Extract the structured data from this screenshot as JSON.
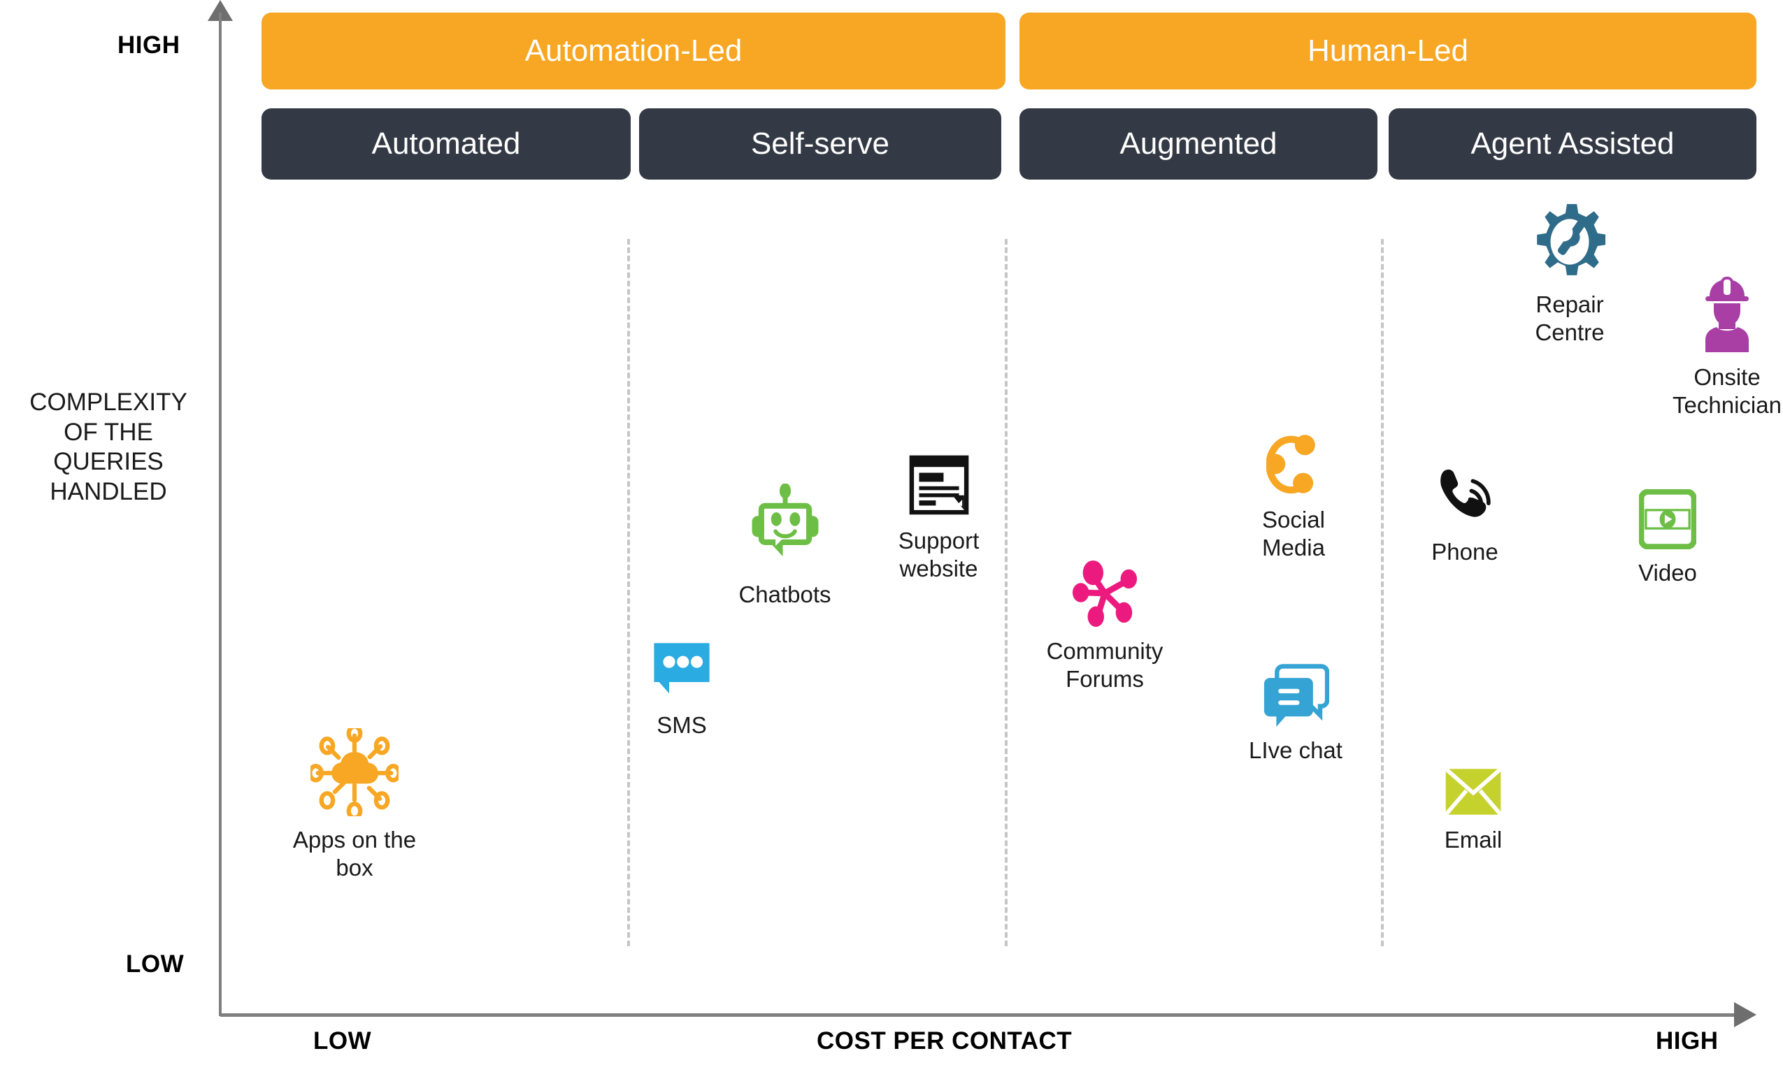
{
  "axes": {
    "y_title": "COMPLEXITY\nOF THE\nQUERIES\nHANDLED",
    "y_high": "HIGH",
    "y_low": "LOW",
    "x_title": "COST PER CONTACT",
    "x_low": "LOW",
    "x_high": "HIGH"
  },
  "groups": [
    {
      "id": "automation-led",
      "label": "Automation-Led",
      "color": "#f7a723"
    },
    {
      "id": "human-led",
      "label": "Human-Led",
      "color": "#f7a723"
    }
  ],
  "columns": [
    {
      "id": "automated",
      "label": "Automated",
      "color": "#343a45"
    },
    {
      "id": "self-serve",
      "label": "Self-serve",
      "color": "#343a45"
    },
    {
      "id": "augmented",
      "label": "Augmented",
      "color": "#343a45"
    },
    {
      "id": "agent-assisted",
      "label": "Agent Assisted",
      "color": "#343a45"
    }
  ],
  "items": [
    {
      "id": "apps-on-the-box",
      "label": "Apps on the\nbox",
      "icon": "network-cloud-icon",
      "color": "#f7a723",
      "column": "automated"
    },
    {
      "id": "sms",
      "label": "SMS",
      "icon": "sms-bubble-icon",
      "color": "#2aabe2",
      "column": "self-serve"
    },
    {
      "id": "chatbots",
      "label": "Chatbots",
      "icon": "robot-icon",
      "color": "#6cbe45",
      "column": "self-serve"
    },
    {
      "id": "support-website",
      "label": "Support\nwebsite",
      "icon": "document-page-icon",
      "color": "#111111",
      "column": "self-serve"
    },
    {
      "id": "community-forums",
      "label": "Community\nForums",
      "icon": "hub-network-icon",
      "color": "#ec1a7e",
      "column": "augmented"
    },
    {
      "id": "social-media",
      "label": "Social\nMedia",
      "icon": "share-nodes-icon",
      "color": "#f7a723",
      "column": "augmented"
    },
    {
      "id": "live-chat",
      "label": "LIve chat",
      "icon": "chat-bubbles-icon",
      "color": "#35a3d4",
      "column": "augmented"
    },
    {
      "id": "phone",
      "label": "Phone",
      "icon": "phone-ringing-icon",
      "color": "#111111",
      "column": "agent-assisted"
    },
    {
      "id": "email",
      "label": "Email",
      "icon": "envelope-icon",
      "color": "#c5d22e",
      "column": "agent-assisted"
    },
    {
      "id": "repair-centre",
      "label": "Repair\nCentre",
      "icon": "gear-wrench-icon",
      "color": "#2e6c8a",
      "column": "agent-assisted"
    },
    {
      "id": "onsite-technician",
      "label": "Onsite\nTechnician",
      "icon": "technician-icon",
      "color": "#a93fa5",
      "column": "agent-assisted"
    },
    {
      "id": "video",
      "label": "Video",
      "icon": "film-play-icon",
      "color": "#6cbe45",
      "column": "agent-assisted"
    }
  ],
  "chart_data": {
    "type": "scatter",
    "title": "",
    "xlabel": "COST PER CONTACT",
    "ylabel": "COMPLEXITY OF THE QUERIES HANDLED",
    "xlim": [
      "LOW",
      "HIGH"
    ],
    "ylim": [
      "LOW",
      "HIGH"
    ],
    "grid": false,
    "legend": "none",
    "points": [
      {
        "label": "Apps on the box",
        "x": "low",
        "y": "low",
        "group": "Automation-Led",
        "column": "Automated"
      },
      {
        "label": "SMS",
        "x": "low-mid",
        "y": "low-mid",
        "group": "Automation-Led",
        "column": "Self-serve"
      },
      {
        "label": "Chatbots",
        "x": "mid-low",
        "y": "mid",
        "group": "Automation-Led",
        "column": "Self-serve"
      },
      {
        "label": "Support website",
        "x": "mid",
        "y": "mid-high",
        "group": "Automation-Led",
        "column": "Self-serve"
      },
      {
        "label": "Community Forums",
        "x": "mid",
        "y": "mid-low",
        "group": "Human-Led",
        "column": "Augmented"
      },
      {
        "label": "Social Media",
        "x": "mid-high",
        "y": "mid-high",
        "group": "Human-Led",
        "column": "Augmented"
      },
      {
        "label": "LIve chat",
        "x": "mid-high",
        "y": "low-mid",
        "group": "Human-Led",
        "column": "Augmented"
      },
      {
        "label": "Phone",
        "x": "high-mid",
        "y": "mid",
        "group": "Human-Led",
        "column": "Agent Assisted"
      },
      {
        "label": "Email",
        "x": "high-mid",
        "y": "low",
        "group": "Human-Led",
        "column": "Agent Assisted"
      },
      {
        "label": "Repair Centre",
        "x": "high",
        "y": "high",
        "group": "Human-Led",
        "column": "Agent Assisted"
      },
      {
        "label": "Onsite Technician",
        "x": "very-high",
        "y": "high",
        "group": "Human-Led",
        "column": "Agent Assisted"
      },
      {
        "label": "Video",
        "x": "very-high",
        "y": "mid",
        "group": "Human-Led",
        "column": "Agent Assisted"
      }
    ]
  }
}
